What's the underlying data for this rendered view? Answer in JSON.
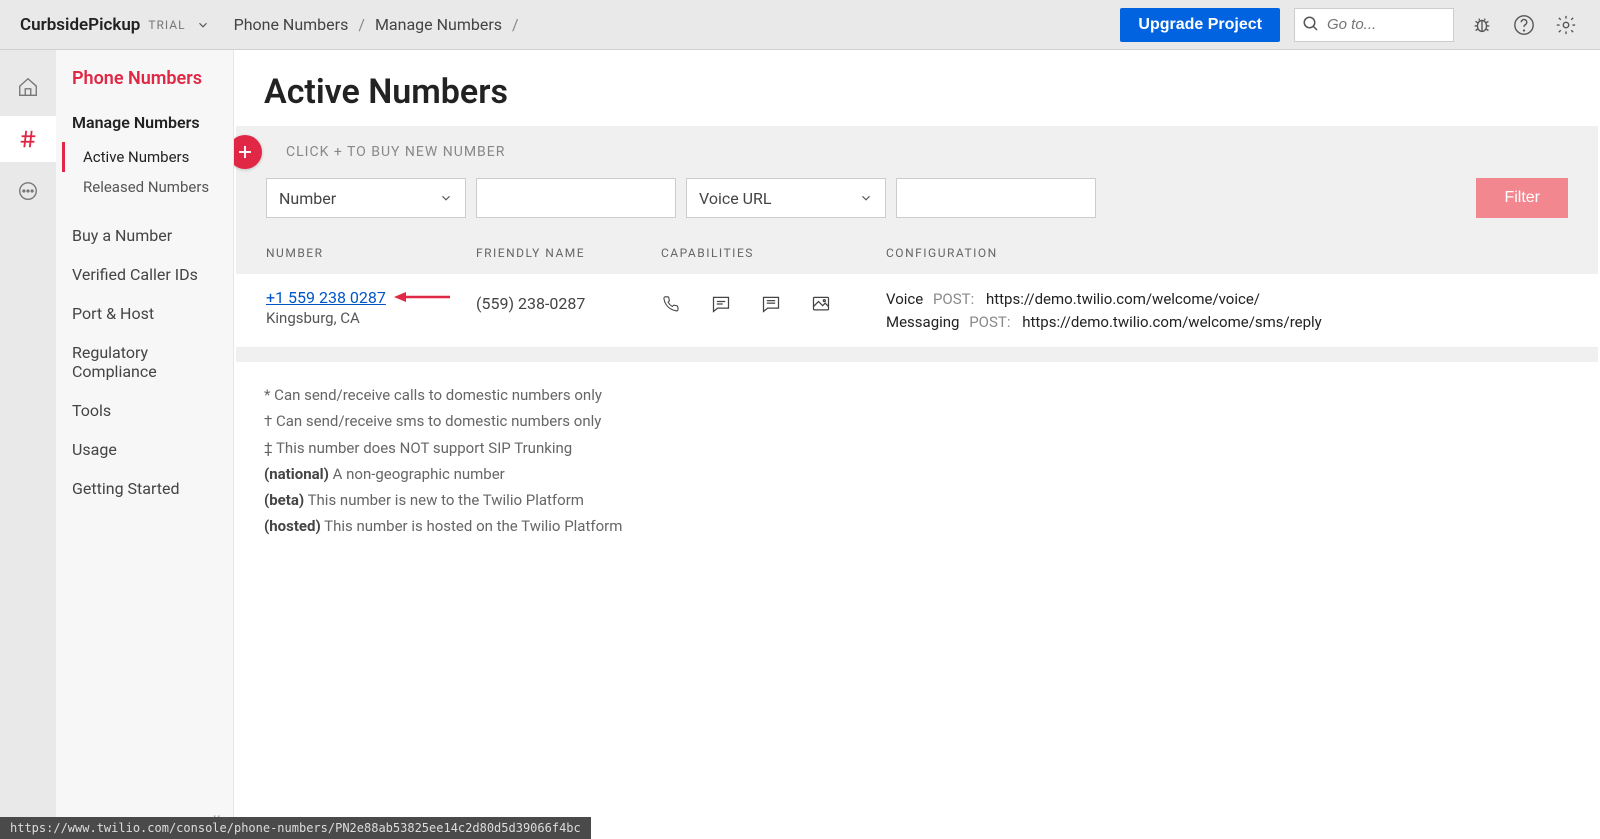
{
  "header": {
    "project_name": "CurbsidePickup",
    "trial_label": "TRIAL",
    "breadcrumb": [
      "Phone Numbers",
      "Manage Numbers"
    ],
    "upgrade_label": "Upgrade Project",
    "search_placeholder": "Go to..."
  },
  "sidebar": {
    "title": "Phone Numbers",
    "section_label": "Manage Numbers",
    "sub_items": [
      {
        "label": "Active Numbers",
        "active": true
      },
      {
        "label": "Released Numbers",
        "active": false
      }
    ],
    "links": [
      "Buy a Number",
      "Verified Caller IDs",
      "Port & Host",
      "Regulatory Compliance",
      "Tools",
      "Usage",
      "Getting Started"
    ]
  },
  "main": {
    "page_title": "Active Numbers",
    "add_hint": "CLICK + TO BUY NEW NUMBER",
    "filters": {
      "select1": "Number",
      "select2": "Voice URL",
      "button": "Filter"
    },
    "columns": {
      "number": "NUMBER",
      "friendly": "FRIENDLY NAME",
      "capabilities": "CAPABILITIES",
      "configuration": "CONFIGURATION"
    },
    "rows": [
      {
        "phone": "+1 559 238 0287",
        "location": "Kingsburg, CA",
        "friendly": "(559) 238-0287",
        "config_voice_label": "Voice",
        "config_voice_method": "POST:",
        "config_voice_url": "https://demo.twilio.com/welcome/voice/",
        "config_msg_label": "Messaging",
        "config_msg_method": "POST:",
        "config_msg_url": "https://demo.twilio.com/welcome/sms/reply"
      }
    ],
    "footnotes": {
      "n1": "* Can send/receive calls to domestic numbers only",
      "n2": "† Can send/receive sms to domestic numbers only",
      "n3": "‡ This number does NOT support SIP Trunking",
      "n4_bold": "(national)",
      "n4_text": " A non-geographic number",
      "n5_bold": "(beta)",
      "n5_text": " This number is new to the Twilio Platform",
      "n6_bold": "(hosted)",
      "n6_text": " This number is hosted on the Twilio Platform"
    }
  },
  "status_bar": "https://www.twilio.com/console/phone-numbers/PN2e88ab53825ee14c2d80d5d39066f4bc"
}
